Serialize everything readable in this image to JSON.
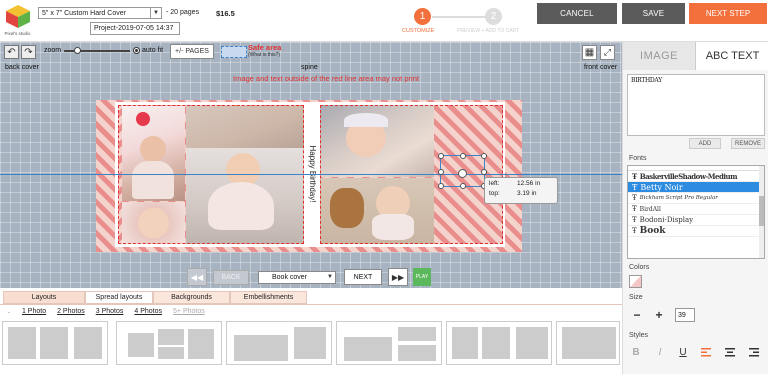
{
  "header": {
    "logo_text": "Pixel's studio",
    "size_select": "5\" x 7\" Custom Hard Cover",
    "pages_label": "- 20 pages",
    "price": "$16.5",
    "project_name": "Project-2019-07-05 14:37",
    "steps": [
      {
        "number": "1",
        "label": "CUSTOMIZE",
        "active": true
      },
      {
        "number": "2",
        "label": "PREVIEW + ADD TO CART",
        "active": false
      }
    ],
    "cancel_label": "CANCEL",
    "save_label": "SAVE",
    "next_step_label": "NEXT STEP"
  },
  "toolbar": {
    "zoom_label": "zoom",
    "autofit_label": "auto fit",
    "pages_button": "+/- PAGES",
    "safe_area_title": "Safe area",
    "safe_area_link": "(What is this?)",
    "back_cover": "back cover",
    "spine": "spine",
    "front_cover": "front cover",
    "warning": "Image and text outside of the red line area may not print"
  },
  "canvas": {
    "spine_text": "Happy Birthday!",
    "tooltip": {
      "left_label": "left:",
      "left_value": "12.56 in",
      "top_label": "top:",
      "top_value": "3.19 in"
    }
  },
  "nav": {
    "back_label": "BACK",
    "page_select": "Book cover",
    "next_label": "NEXT",
    "play_label": "PLAY"
  },
  "bottom_tabs": [
    "Layouts",
    "Spread layouts",
    "Backgrounds",
    "Embellishments"
  ],
  "photo_filters": [
    "1 Photo",
    "2 Photos",
    "3 Photos",
    "4 Photos",
    "5+ Photos"
  ],
  "right_panel": {
    "tab_image": "IMAGE",
    "tab_text": "ABC TEXT",
    "text_value": "BIRTHDAY",
    "add_label": "ADD",
    "remove_label": "REMOVE",
    "fonts_label": "Fonts",
    "fonts": [
      "BaskervilleShadow-Medium",
      "Betty Noir",
      "Bickham Script Pro Regular",
      "BirdAll",
      "Bodoni-Display",
      "Book"
    ],
    "selected_font": "Betty Noir",
    "colors_label": "Colors",
    "size_label": "Size",
    "size_value": "39",
    "styles_label": "Styles",
    "style_bold": "B",
    "style_italic": "I",
    "style_underline": "U"
  },
  "colors": {
    "accent": "#f36f3b",
    "dark_button": "#5b5b5b",
    "safe_line": "#e0312f",
    "play": "#5cb85c"
  }
}
